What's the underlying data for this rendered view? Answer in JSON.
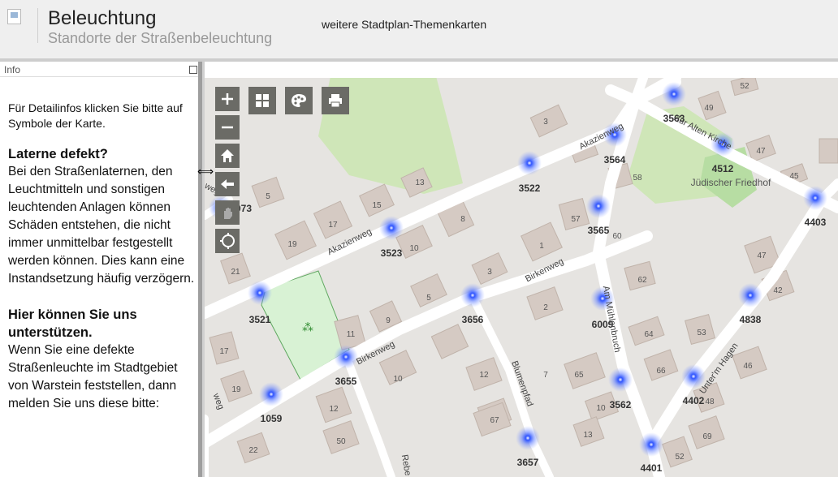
{
  "header": {
    "title": "Beleuchtung",
    "subtitle": "Standorte der Straßenbeleuchtung",
    "themes_link": "weitere Stadtplan-Themenkarten"
  },
  "info_panel": {
    "title": "Info",
    "hint": "Für Detailinfos klicken Sie bitte auf Symbole der Karte.",
    "section1_heading": "Laterne defekt?",
    "section1_body": "Bei den Straßenlaternen, den Leuchtmitteln und sonstigen leuchtenden Anlagen können Schäden entstehen, die nicht immer unmittelbar festgestellt werden können. Dies kann eine Instandsetzung häufig verzögern.",
    "section2_heading": "Hier können Sie uns unterstützen.",
    "section2_body": "Wenn Sie eine defekte Straßenleuchte im Stadtgebiet von Warstein feststellen, dann melden Sie uns diese bitte:"
  },
  "map": {
    "controls": [
      {
        "name": "zoom-in-button",
        "icon": "plus-icon"
      },
      {
        "name": "zoom-out-button",
        "icon": "minus-icon"
      },
      {
        "name": "home-button",
        "icon": "home-icon"
      },
      {
        "name": "back-button",
        "icon": "arrow-left-icon"
      },
      {
        "name": "pan-button",
        "icon": "hand-icon"
      },
      {
        "name": "locate-button",
        "icon": "crosshair-icon"
      },
      {
        "name": "basemap-button",
        "icon": "grid-icon"
      },
      {
        "name": "layers-button",
        "icon": "palette-icon"
      },
      {
        "name": "print-button",
        "icon": "printer-icon"
      }
    ],
    "street_labels": [
      "Akazienweg",
      "Akazienweg",
      "Birkenweg",
      "Birkenweg",
      "Am Mühlenbruch",
      "Blumenpfad",
      "Unter'm Hagen",
      "Zur Alten Kirche",
      "Rebe",
      "weg",
      "weg"
    ],
    "place_labels": [
      "Jüdischer Friedhof"
    ],
    "lamp_ids": [
      "3563",
      "4512",
      "3564",
      "3522",
      "3565",
      "4403",
      "073",
      "3523",
      "3521",
      "3656",
      "6009",
      "4838",
      "3655",
      "4402",
      "3562",
      "1059",
      "3657",
      "4401"
    ],
    "house_numbers": [
      "52",
      "49",
      "3",
      "47",
      "45",
      "58",
      "13",
      "5",
      "15",
      "17",
      "8",
      "57",
      "60",
      "19",
      "10",
      "1",
      "3",
      "21",
      "5",
      "62",
      "2",
      "9",
      "11",
      "47",
      "42",
      "64",
      "53",
      "17",
      "10",
      "12",
      "7",
      "65",
      "66",
      "46",
      "48",
      "19",
      "12",
      "67",
      "10",
      "69",
      "50",
      "22",
      "13",
      "52"
    ],
    "colors": {
      "background": "#e6e4e1",
      "road": "#ffffff",
      "building": "#d5cac3",
      "green": "#cfe6b8",
      "lamp": "#3d5bff",
      "highlight": "#d8f2d4"
    }
  }
}
